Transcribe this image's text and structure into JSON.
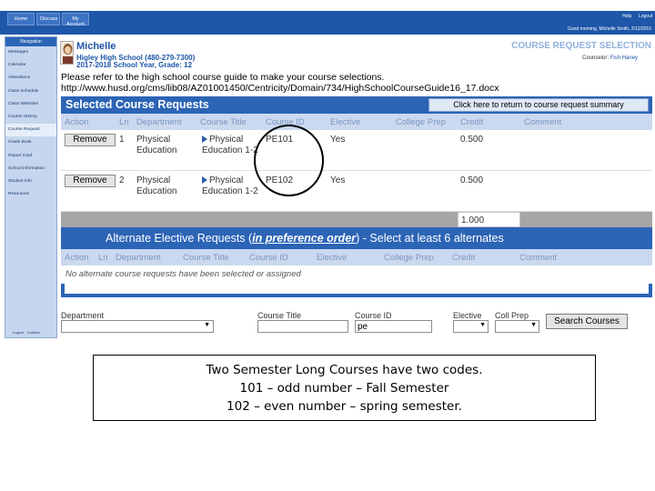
{
  "topnav": {
    "tabs": [
      "Home",
      "Discuss",
      "My Account"
    ],
    "help": "Help",
    "logout": "Logout",
    "greeting": "Good morning, Michelle Smith, 2/12/2015"
  },
  "sidebar": {
    "header": "Navigation",
    "items": [
      "Messages",
      "Calendar",
      "Attendance",
      "Class Schedule",
      "Class Websites",
      "Course History",
      "Course Request",
      "Grade Book",
      "Report Card",
      "School Information",
      "Student Info",
      "Resources"
    ],
    "footer": "Logout · Contact"
  },
  "student": {
    "name": "Michelle",
    "school": "Higley High School (480-279-7300)",
    "year": "2017-2018 School Year, Grade: 12"
  },
  "page_heading": "COURSE REQUEST SELECTION",
  "counselor": {
    "label": "Counselor:",
    "name": "Fish Haney"
  },
  "guide_note": "Please refer to the high school course guide to make your course selections.",
  "guide_url": "http://www.husd.org/cms/lib08/AZ01001450/Centricity/Domain/734/HighSchoolCourseGuide16_17.docx",
  "selected": {
    "title": "Selected Course Requests",
    "return_button": "Click here to return to course request summary",
    "columns": [
      "Action",
      "Ln",
      "Department",
      "Course Title",
      "Course ID",
      "Elective",
      "College Prep",
      "Credit",
      "Comment"
    ],
    "rows": [
      {
        "action": "Remove",
        "ln": "1",
        "department": "Physical Education",
        "title": "Physical Education 1-2",
        "course_id": "PE101",
        "elective": "Yes",
        "college_prep": "",
        "credit": "0.500",
        "comment": ""
      },
      {
        "action": "Remove",
        "ln": "2",
        "department": "Physical Education",
        "title": "Physical Education 1-2",
        "course_id": "PE102",
        "elective": "Yes",
        "college_prep": "",
        "credit": "0.500",
        "comment": ""
      }
    ],
    "total_credit": "1.000"
  },
  "alternates": {
    "title_prefix": "Alternate Elective Requests (",
    "title_emphasis": "in preference order",
    "title_suffix": ") - Select at least 6 alternates",
    "columns": [
      "Action",
      "Ln",
      "Department",
      "Course Title",
      "Course ID",
      "Elective",
      "College Prep",
      "Credit",
      "Comment"
    ],
    "empty_message": "No alternate course requests have been selected or assigned"
  },
  "search": {
    "department_label": "Department",
    "department_value": "",
    "title_label": "Course Title",
    "title_value": "",
    "id_label": "Course ID",
    "id_value": "pe",
    "elective_label": "Elective",
    "collprep_label": "Coll Prep",
    "button": "Search Courses"
  },
  "caption": {
    "line1": "Two Semester Long Courses have two codes.",
    "line2": "101 – odd number – Fall Semester",
    "line3": "102 – even number – spring semester."
  }
}
